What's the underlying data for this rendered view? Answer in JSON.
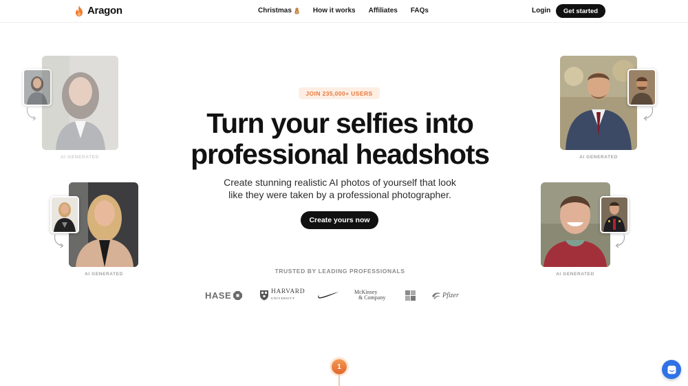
{
  "nav": {
    "brand": "Aragon",
    "links": [
      "Christmas",
      "How it works",
      "Affiliates",
      "FAQs"
    ],
    "login": "Login",
    "get_started": "Get started"
  },
  "hero": {
    "badge": "JOIN 235,000+ USERS",
    "headline_line1": "Turn your selfies into",
    "headline_line2": "professional headshots",
    "sub_line1": "Create stunning realistic AI photos of yourself that look",
    "sub_line2": "like they were taken by a professional photographer.",
    "cta": "Create yours now",
    "trusted": "TRUSTED BY LEADING PROFESSIONALS"
  },
  "cards": {
    "label": "AI GENERATED"
  },
  "logos": {
    "chase": "HASE",
    "harvard_main": "HARVARD",
    "harvard_sub": "UNIVERSITY",
    "mckinsey_1": "McKinsey",
    "mckinsey_2": "& Company",
    "pfizer": "Pfizer"
  },
  "step": {
    "number": "1"
  },
  "colors": {
    "accent": "#e8793d",
    "cta": "#111111",
    "chat": "#2f72e6"
  }
}
